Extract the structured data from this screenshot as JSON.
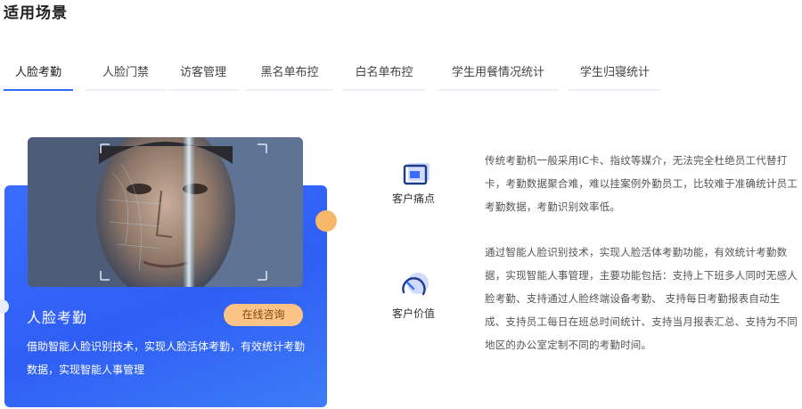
{
  "section_title": "适用场景",
  "tabs": [
    {
      "label": "人脸考勤",
      "active": true
    },
    {
      "label": "人脸门禁",
      "active": false
    },
    {
      "label": "访客管理",
      "active": false
    },
    {
      "label": "黑名单布控",
      "active": false
    },
    {
      "label": "白名单布控",
      "active": false
    },
    {
      "label": "学生用餐情况统计",
      "active": false
    },
    {
      "label": "学生归寝统计",
      "active": false
    }
  ],
  "card": {
    "title": "人脸考勤",
    "button_label": "在线咨询",
    "description": "借助智能人脸识别技术，实现人脸活体考勤，有效统计考勤数据，实现智能人事管理",
    "accent_color": "#3a6dff",
    "button_color": "#fbc486"
  },
  "pain_point": {
    "label": "客户痛点",
    "icon": "monitor-icon",
    "text": "传统考勤机一般采用IC卡、指纹等媒介，无法完全杜绝员工代替打卡，考勤数据聚合难，难以挂案例外勤员工，比较难于准确统计员工考勤数据，考勤识别效率低。"
  },
  "customer_value": {
    "label": "客户价值",
    "icon": "gauge-icon",
    "text": "通过智能人脸识别技术，实现人脸活体考勤功能，有效统计考勤数据，实现智能人事管理，主要功能包括：支持上下班多人同时无感人脸考勤、支持通过人脸终端设备考勤、 支持每日考勤报表自动生成、支持员工每日在班总时间统计、支持当月报表汇总、支持为不同地区的办公室定制不同的考勤时间。"
  }
}
